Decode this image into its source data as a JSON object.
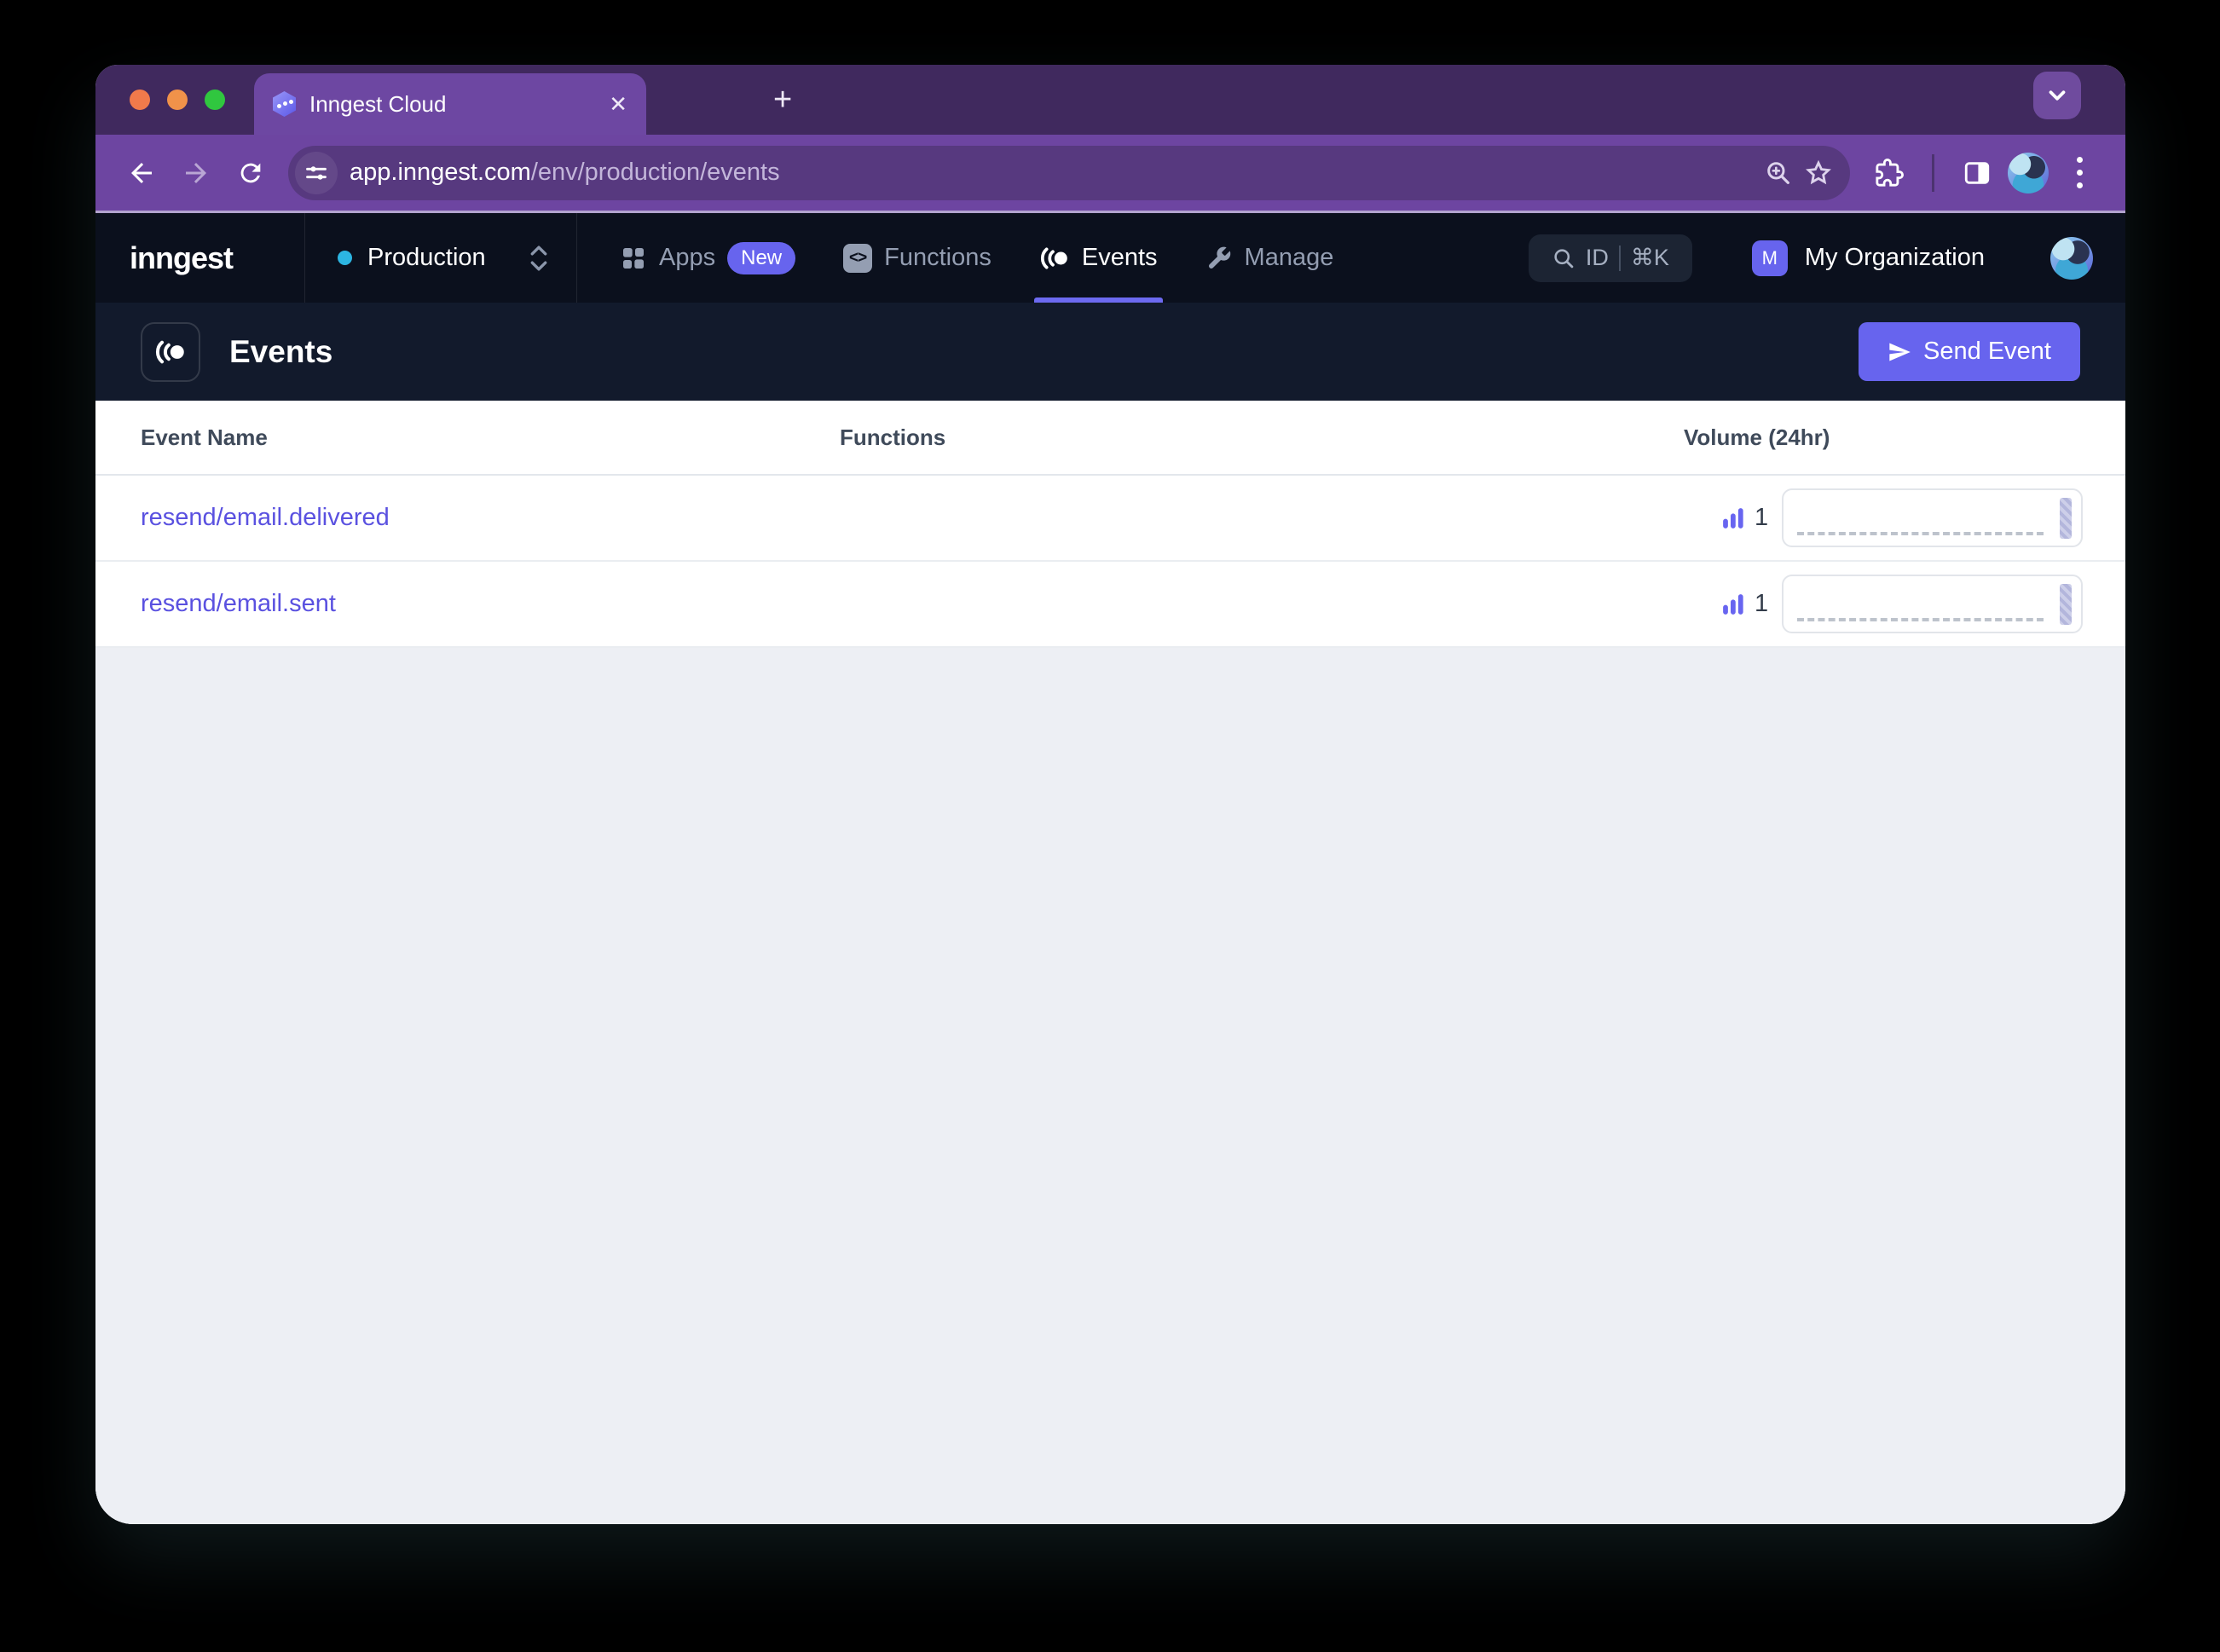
{
  "browser": {
    "tab": {
      "title": "Inngest Cloud",
      "close_glyph": "✕",
      "new_tab_glyph": "+"
    },
    "url": {
      "domain": "app.inngest.com",
      "path": "/env/production/events"
    }
  },
  "nav": {
    "logo": "inngest",
    "env_switcher": {
      "label": "Production",
      "status_dot_color": "#2cb5e2"
    },
    "items": [
      {
        "label": "Apps",
        "badge": "New"
      },
      {
        "label": "Functions"
      },
      {
        "label": "Events",
        "active": true
      },
      {
        "label": "Manage"
      }
    ],
    "search": {
      "label": "ID",
      "shortcut": "⌘K"
    },
    "org": {
      "initial": "M",
      "name": "My Organization"
    }
  },
  "page": {
    "title": "Events",
    "send_event_label": "Send Event"
  },
  "table": {
    "columns": [
      "Event Name",
      "Functions",
      "Volume (24hr)"
    ],
    "rows": [
      {
        "event_name": "resend/email.delivered",
        "functions": "",
        "volume": "1"
      },
      {
        "event_name": "resend/email.sent",
        "functions": "",
        "volume": "1"
      }
    ],
    "sparkline_note": "single bar at far right of 24hr mini chart"
  },
  "colors": {
    "accent_indigo": "#6764ee",
    "active_underline": "#6d6af0",
    "event_link": "#5a51e0",
    "browser_chrome": "#6d45a1",
    "tab_strip": "#40295e",
    "app_nav_bg": "#0b101d",
    "page_header_bg": "#121a2c",
    "production_dot": "#2cb5e2"
  }
}
